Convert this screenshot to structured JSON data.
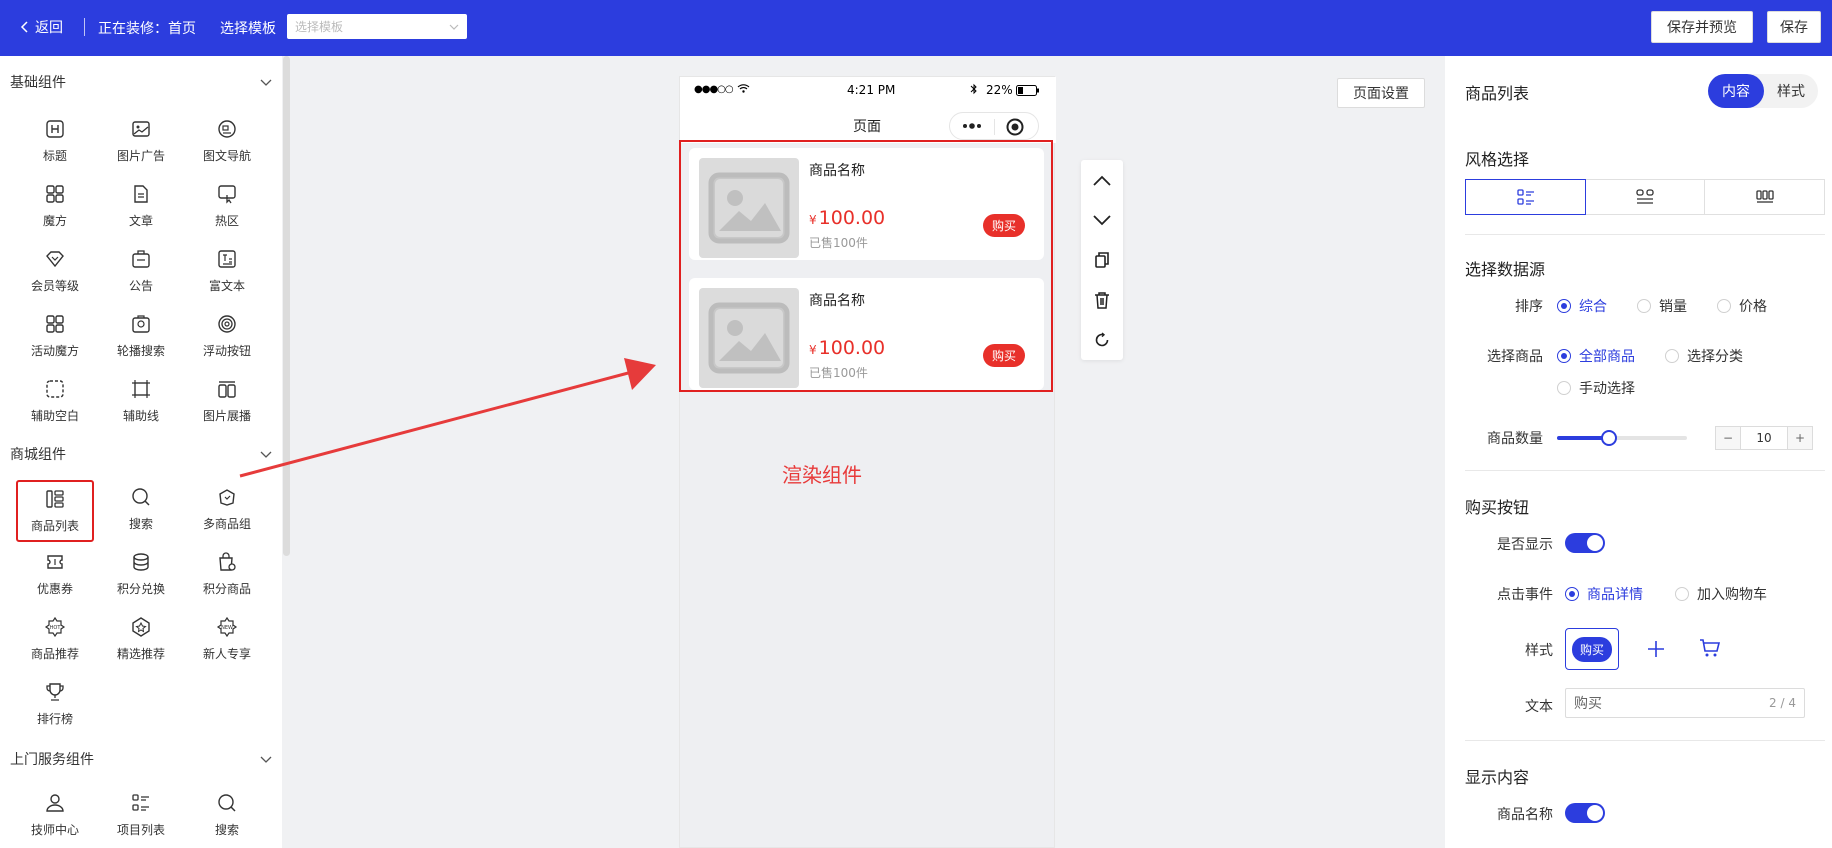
{
  "topbar": {
    "back_label": "返回",
    "editing_label": "正在装修：首页",
    "template_label": "选择模板",
    "template_placeholder": "选择模板",
    "preview_save_label": "保存并预览",
    "save_label": "保存"
  },
  "left_panel": {
    "categories": [
      {
        "title": "基础组件",
        "items": [
          {
            "label": "标题",
            "icon": "heading-icon"
          },
          {
            "label": "图片广告",
            "icon": "image-ad-icon"
          },
          {
            "label": "图文导航",
            "icon": "image-text-nav-icon"
          },
          {
            "label": "魔方",
            "icon": "cube-icon"
          },
          {
            "label": "文章",
            "icon": "article-icon"
          },
          {
            "label": "热区",
            "icon": "hotspot-icon"
          },
          {
            "label": "会员等级",
            "icon": "member-level-icon"
          },
          {
            "label": "公告",
            "icon": "notice-icon"
          },
          {
            "label": "富文本",
            "icon": "rich-text-icon"
          },
          {
            "label": "活动魔方",
            "icon": "activity-cube-icon"
          },
          {
            "label": "轮播搜索",
            "icon": "carousel-search-icon"
          },
          {
            "label": "浮动按钮",
            "icon": "float-button-icon"
          },
          {
            "label": "辅助空白",
            "icon": "blank-icon"
          },
          {
            "label": "辅助线",
            "icon": "divider-line-icon"
          },
          {
            "label": "图片展播",
            "icon": "image-show-icon"
          }
        ]
      },
      {
        "title": "商城组件",
        "items": [
          {
            "label": "商品列表",
            "icon": "product-list-icon"
          },
          {
            "label": "搜索",
            "icon": "search-icon"
          },
          {
            "label": "多商品组",
            "icon": "multi-product-icon"
          },
          {
            "label": "优惠券",
            "icon": "coupon-icon"
          },
          {
            "label": "积分兑换",
            "icon": "points-exchange-icon"
          },
          {
            "label": "积分商品",
            "icon": "points-product-icon"
          },
          {
            "label": "商品推荐",
            "icon": "hot-recommend-icon"
          },
          {
            "label": "精选推荐",
            "icon": "featured-icon"
          },
          {
            "label": "新人专享",
            "icon": "new-user-icon"
          },
          {
            "label": "排行榜",
            "icon": "ranking-icon"
          }
        ]
      },
      {
        "title": "上门服务组件",
        "items": [
          {
            "label": "技师中心",
            "icon": "technician-icon"
          },
          {
            "label": "项目列表",
            "icon": "project-list-icon"
          },
          {
            "label": "搜索",
            "icon": "search-icon"
          }
        ]
      }
    ]
  },
  "phone": {
    "status_signal": "●●●○○",
    "status_time": "4:21 PM",
    "status_battery": "22%",
    "nav_title": "页面",
    "products": [
      {
        "name": "商品名称",
        "currency": "¥",
        "price": "100.00",
        "sold": "已售100件",
        "buy": "购买"
      },
      {
        "name": "商品名称",
        "currency": "¥",
        "price": "100.00",
        "sold": "已售100件",
        "buy": "购买"
      }
    ]
  },
  "canvas": {
    "render_label": "渲染组件",
    "page_settings_label": "页面设置"
  },
  "right_panel": {
    "title": "商品列表",
    "tab_content": "内容",
    "tab_style": "样式",
    "style_section": "风格选择",
    "data_section": "选择数据源",
    "sort_label": "排序",
    "sort_options": [
      "综合",
      "销量",
      "价格"
    ],
    "select_label": "选择商品",
    "select_options": [
      "全部商品",
      "选择分类",
      "手动选择"
    ],
    "count_label": "商品数量",
    "count_value": "10",
    "count_fraction": 0.4,
    "stepper_minus": "−",
    "stepper_plus": "+",
    "buy_section": "购买按钮",
    "show_label": "是否显示",
    "click_label": "点击事件",
    "click_options": [
      "商品详情",
      "加入购物车"
    ],
    "style_label": "样式",
    "style_buy_text": "购买",
    "text_label": "文本",
    "text_value": "购买",
    "text_counter": "2 / 4",
    "display_section": "显示内容",
    "product_name_label": "商品名称"
  },
  "colors": {
    "accent": "#2c3dde",
    "price": "#e8302a",
    "highlight": "#e02020"
  }
}
